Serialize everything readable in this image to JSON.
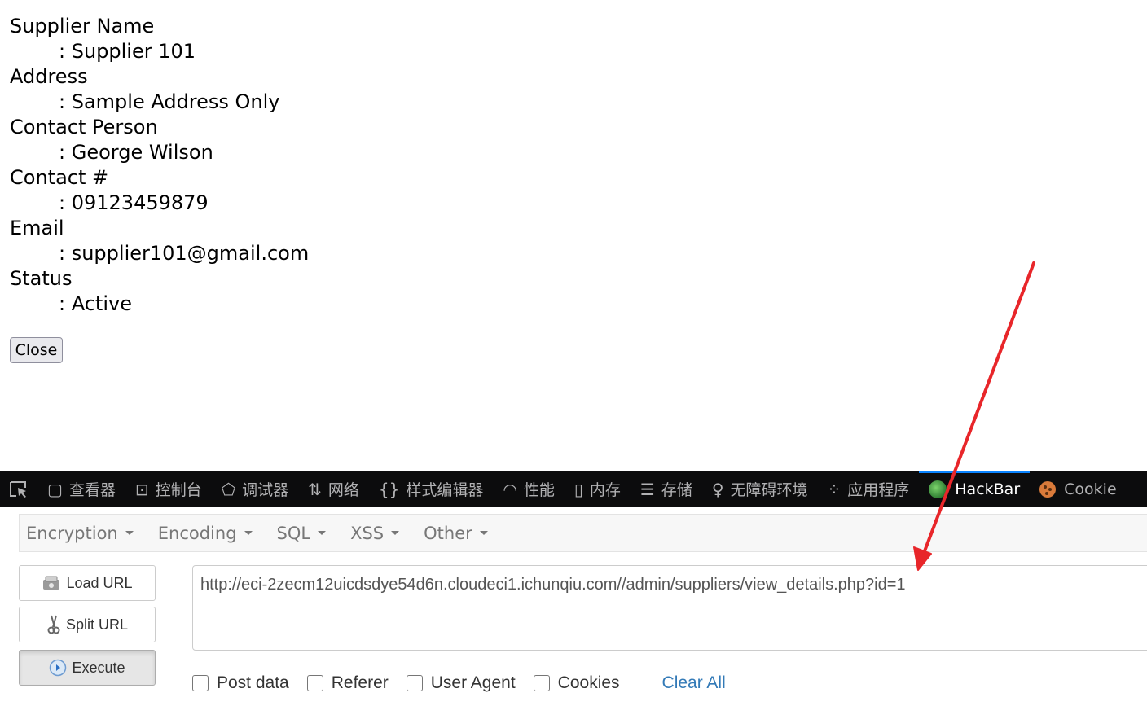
{
  "details": {
    "supplier_name_label": "Supplier Name",
    "supplier_name_value": ": Supplier 101",
    "address_label": "Address",
    "address_value": ": Sample Address Only",
    "contact_person_label": "Contact Person",
    "contact_person_value": ": George Wilson",
    "contact_number_label": "Contact #",
    "contact_number_value": ": 09123459879",
    "email_label": "Email",
    "email_value": ": supplier101@gmail.com",
    "status_label": "Status",
    "status_value": ":  Active",
    "close_label": "Close"
  },
  "devtools": {
    "tabs": [
      {
        "label": "查看器",
        "icon": "inspector-icon"
      },
      {
        "label": "控制台",
        "icon": "console-icon"
      },
      {
        "label": "调试器",
        "icon": "debugger-icon"
      },
      {
        "label": "网络",
        "icon": "network-icon"
      },
      {
        "label": "样式编辑器",
        "icon": "style-editor-icon"
      },
      {
        "label": "性能",
        "icon": "performance-icon"
      },
      {
        "label": "内存",
        "icon": "memory-icon"
      },
      {
        "label": "存储",
        "icon": "storage-icon"
      },
      {
        "label": "无障碍环境",
        "icon": "accessibility-icon"
      },
      {
        "label": "应用程序",
        "icon": "application-icon"
      },
      {
        "label": "HackBar",
        "icon": "hackbar-icon"
      },
      {
        "label": "Cookie",
        "icon": "cookie-icon"
      }
    ],
    "active_tab": "HackBar",
    "accent_color": "#0a84ff"
  },
  "hackbar": {
    "menus": [
      "Encryption",
      "Encoding",
      "SQL",
      "XSS",
      "Other"
    ],
    "load_url_label": "Load URL",
    "split_url_label": "Split URL",
    "execute_label": "Execute",
    "url_value": "http://eci-2zecm12uicdsdye54d6n.cloudeci1.ichunqiu.com//admin/suppliers/view_details.php?id=1",
    "options": {
      "post_data": "Post data",
      "referer": "Referer",
      "user_agent": "User Agent",
      "cookies": "Cookies"
    },
    "clear_all_label": "Clear All",
    "link_color": "#337ab7"
  },
  "annotation": {
    "arrow_color": "#e8262a"
  }
}
